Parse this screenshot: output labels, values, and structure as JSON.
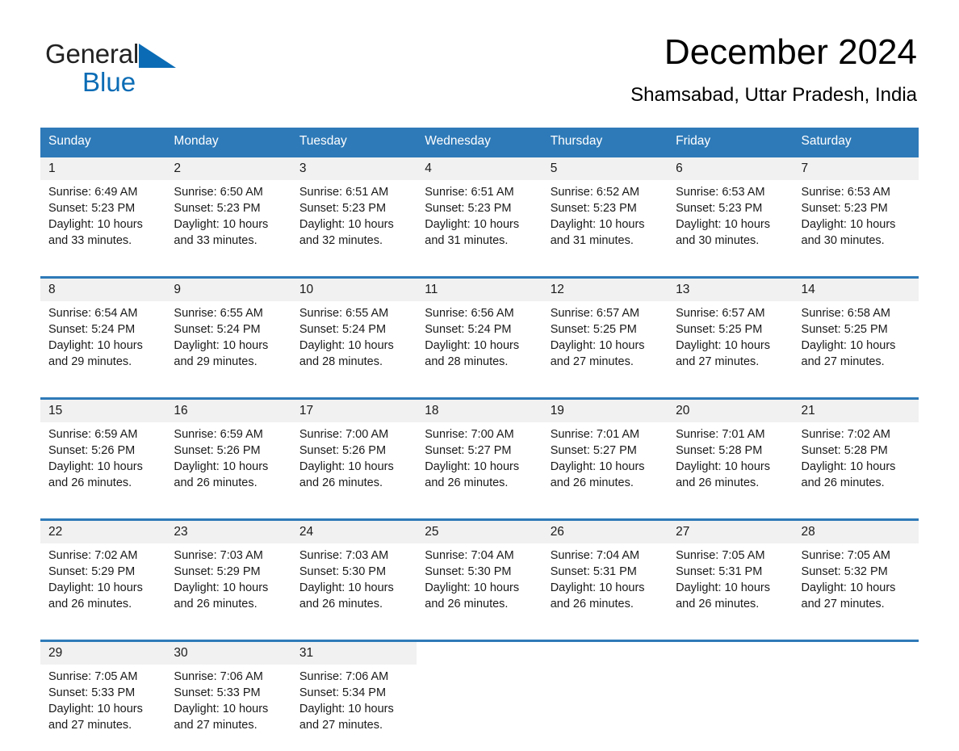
{
  "logo": {
    "word1": "General",
    "word2": "Blue",
    "triangle_color": "#0b6cb5",
    "text_color": "#222222"
  },
  "header": {
    "title": "December 2024",
    "subtitle": "Shamsabad, Uttar Pradesh, India"
  },
  "theme": {
    "header_blue": "#2e7ab8",
    "daynum_bg": "#f1f1f1",
    "cell_bg": "#ffffff",
    "text": "#1a1a1a"
  },
  "weekdays": [
    "Sunday",
    "Monday",
    "Tuesday",
    "Wednesday",
    "Thursday",
    "Friday",
    "Saturday"
  ],
  "weeks": [
    [
      {
        "day": "1",
        "sunrise": "Sunrise: 6:49 AM",
        "sunset": "Sunset: 5:23 PM",
        "daylight1": "Daylight: 10 hours",
        "daylight2": "and 33 minutes."
      },
      {
        "day": "2",
        "sunrise": "Sunrise: 6:50 AM",
        "sunset": "Sunset: 5:23 PM",
        "daylight1": "Daylight: 10 hours",
        "daylight2": "and 33 minutes."
      },
      {
        "day": "3",
        "sunrise": "Sunrise: 6:51 AM",
        "sunset": "Sunset: 5:23 PM",
        "daylight1": "Daylight: 10 hours",
        "daylight2": "and 32 minutes."
      },
      {
        "day": "4",
        "sunrise": "Sunrise: 6:51 AM",
        "sunset": "Sunset: 5:23 PM",
        "daylight1": "Daylight: 10 hours",
        "daylight2": "and 31 minutes."
      },
      {
        "day": "5",
        "sunrise": "Sunrise: 6:52 AM",
        "sunset": "Sunset: 5:23 PM",
        "daylight1": "Daylight: 10 hours",
        "daylight2": "and 31 minutes."
      },
      {
        "day": "6",
        "sunrise": "Sunrise: 6:53 AM",
        "sunset": "Sunset: 5:23 PM",
        "daylight1": "Daylight: 10 hours",
        "daylight2": "and 30 minutes."
      },
      {
        "day": "7",
        "sunrise": "Sunrise: 6:53 AM",
        "sunset": "Sunset: 5:23 PM",
        "daylight1": "Daylight: 10 hours",
        "daylight2": "and 30 minutes."
      }
    ],
    [
      {
        "day": "8",
        "sunrise": "Sunrise: 6:54 AM",
        "sunset": "Sunset: 5:24 PM",
        "daylight1": "Daylight: 10 hours",
        "daylight2": "and 29 minutes."
      },
      {
        "day": "9",
        "sunrise": "Sunrise: 6:55 AM",
        "sunset": "Sunset: 5:24 PM",
        "daylight1": "Daylight: 10 hours",
        "daylight2": "and 29 minutes."
      },
      {
        "day": "10",
        "sunrise": "Sunrise: 6:55 AM",
        "sunset": "Sunset: 5:24 PM",
        "daylight1": "Daylight: 10 hours",
        "daylight2": "and 28 minutes."
      },
      {
        "day": "11",
        "sunrise": "Sunrise: 6:56 AM",
        "sunset": "Sunset: 5:24 PM",
        "daylight1": "Daylight: 10 hours",
        "daylight2": "and 28 minutes."
      },
      {
        "day": "12",
        "sunrise": "Sunrise: 6:57 AM",
        "sunset": "Sunset: 5:25 PM",
        "daylight1": "Daylight: 10 hours",
        "daylight2": "and 27 minutes."
      },
      {
        "day": "13",
        "sunrise": "Sunrise: 6:57 AM",
        "sunset": "Sunset: 5:25 PM",
        "daylight1": "Daylight: 10 hours",
        "daylight2": "and 27 minutes."
      },
      {
        "day": "14",
        "sunrise": "Sunrise: 6:58 AM",
        "sunset": "Sunset: 5:25 PM",
        "daylight1": "Daylight: 10 hours",
        "daylight2": "and 27 minutes."
      }
    ],
    [
      {
        "day": "15",
        "sunrise": "Sunrise: 6:59 AM",
        "sunset": "Sunset: 5:26 PM",
        "daylight1": "Daylight: 10 hours",
        "daylight2": "and 26 minutes."
      },
      {
        "day": "16",
        "sunrise": "Sunrise: 6:59 AM",
        "sunset": "Sunset: 5:26 PM",
        "daylight1": "Daylight: 10 hours",
        "daylight2": "and 26 minutes."
      },
      {
        "day": "17",
        "sunrise": "Sunrise: 7:00 AM",
        "sunset": "Sunset: 5:26 PM",
        "daylight1": "Daylight: 10 hours",
        "daylight2": "and 26 minutes."
      },
      {
        "day": "18",
        "sunrise": "Sunrise: 7:00 AM",
        "sunset": "Sunset: 5:27 PM",
        "daylight1": "Daylight: 10 hours",
        "daylight2": "and 26 minutes."
      },
      {
        "day": "19",
        "sunrise": "Sunrise: 7:01 AM",
        "sunset": "Sunset: 5:27 PM",
        "daylight1": "Daylight: 10 hours",
        "daylight2": "and 26 minutes."
      },
      {
        "day": "20",
        "sunrise": "Sunrise: 7:01 AM",
        "sunset": "Sunset: 5:28 PM",
        "daylight1": "Daylight: 10 hours",
        "daylight2": "and 26 minutes."
      },
      {
        "day": "21",
        "sunrise": "Sunrise: 7:02 AM",
        "sunset": "Sunset: 5:28 PM",
        "daylight1": "Daylight: 10 hours",
        "daylight2": "and 26 minutes."
      }
    ],
    [
      {
        "day": "22",
        "sunrise": "Sunrise: 7:02 AM",
        "sunset": "Sunset: 5:29 PM",
        "daylight1": "Daylight: 10 hours",
        "daylight2": "and 26 minutes."
      },
      {
        "day": "23",
        "sunrise": "Sunrise: 7:03 AM",
        "sunset": "Sunset: 5:29 PM",
        "daylight1": "Daylight: 10 hours",
        "daylight2": "and 26 minutes."
      },
      {
        "day": "24",
        "sunrise": "Sunrise: 7:03 AM",
        "sunset": "Sunset: 5:30 PM",
        "daylight1": "Daylight: 10 hours",
        "daylight2": "and 26 minutes."
      },
      {
        "day": "25",
        "sunrise": "Sunrise: 7:04 AM",
        "sunset": "Sunset: 5:30 PM",
        "daylight1": "Daylight: 10 hours",
        "daylight2": "and 26 minutes."
      },
      {
        "day": "26",
        "sunrise": "Sunrise: 7:04 AM",
        "sunset": "Sunset: 5:31 PM",
        "daylight1": "Daylight: 10 hours",
        "daylight2": "and 26 minutes."
      },
      {
        "day": "27",
        "sunrise": "Sunrise: 7:05 AM",
        "sunset": "Sunset: 5:31 PM",
        "daylight1": "Daylight: 10 hours",
        "daylight2": "and 26 minutes."
      },
      {
        "day": "28",
        "sunrise": "Sunrise: 7:05 AM",
        "sunset": "Sunset: 5:32 PM",
        "daylight1": "Daylight: 10 hours",
        "daylight2": "and 27 minutes."
      }
    ],
    [
      {
        "day": "29",
        "sunrise": "Sunrise: 7:05 AM",
        "sunset": "Sunset: 5:33 PM",
        "daylight1": "Daylight: 10 hours",
        "daylight2": "and 27 minutes."
      },
      {
        "day": "30",
        "sunrise": "Sunrise: 7:06 AM",
        "sunset": "Sunset: 5:33 PM",
        "daylight1": "Daylight: 10 hours",
        "daylight2": "and 27 minutes."
      },
      {
        "day": "31",
        "sunrise": "Sunrise: 7:06 AM",
        "sunset": "Sunset: 5:34 PM",
        "daylight1": "Daylight: 10 hours",
        "daylight2": "and 27 minutes."
      },
      {
        "day": "",
        "sunrise": "",
        "sunset": "",
        "daylight1": "",
        "daylight2": ""
      },
      {
        "day": "",
        "sunrise": "",
        "sunset": "",
        "daylight1": "",
        "daylight2": ""
      },
      {
        "day": "",
        "sunrise": "",
        "sunset": "",
        "daylight1": "",
        "daylight2": ""
      },
      {
        "day": "",
        "sunrise": "",
        "sunset": "",
        "daylight1": "",
        "daylight2": ""
      }
    ]
  ]
}
